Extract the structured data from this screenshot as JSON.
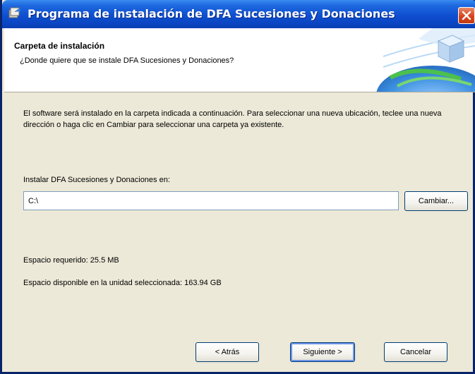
{
  "window": {
    "title": "Programa de instalación de DFA Sucesiones y Donaciones",
    "icons": [
      "installer-app-icon",
      "close-icon"
    ]
  },
  "header": {
    "title": "Carpeta de instalación",
    "subtitle": "¿Donde quiere que se instale DFA Sucesiones y Donaciones?"
  },
  "content": {
    "description": "El software será instalado en la carpeta indicada a continuación. Para seleccionar una nueva ubicación, teclee una nueva dirección o haga clic en Cambiar para seleccionar una carpeta ya existente.",
    "install_label": "Instalar DFA Sucesiones y Donaciones en:",
    "install_path": "C:\\",
    "change_button": "Cambiar...",
    "space_required": "Espacio requerido: 25.5 MB",
    "space_available": "Espacio disponible en la unidad seleccionada: 163.94 GB"
  },
  "footer": {
    "back_button": "< Atrás",
    "next_button": "Siguiente >",
    "cancel_button": "Cancelar"
  }
}
